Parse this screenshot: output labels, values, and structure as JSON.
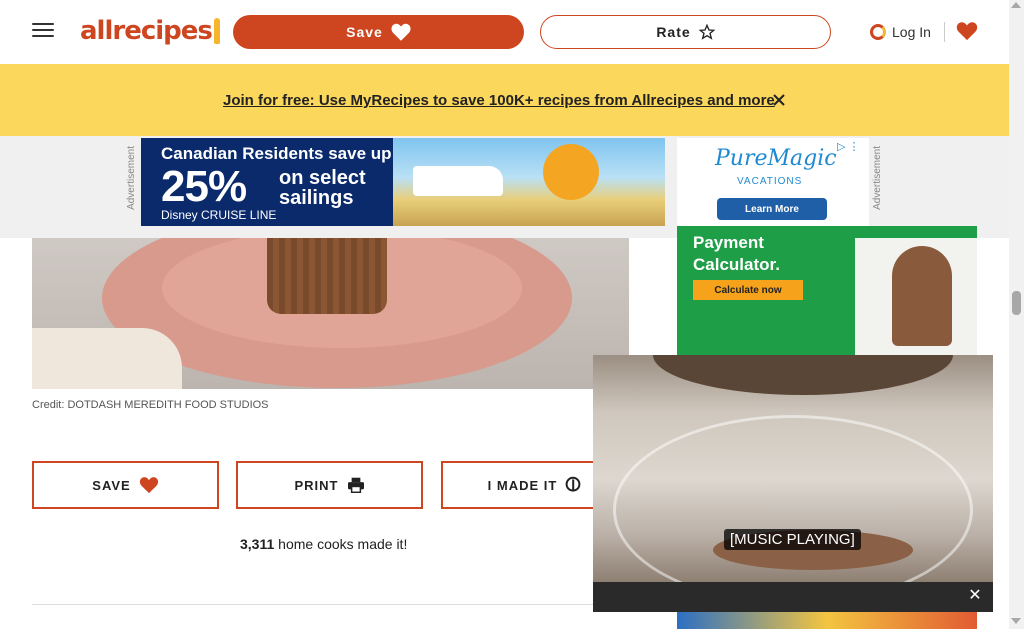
{
  "header": {
    "logo_text": "allrecipes",
    "save_label": "Save",
    "rate_label": "Rate",
    "login_label": "Log In"
  },
  "banner": {
    "text": "Join for free: Use MyRecipes to save 100K+ recipes from Allrecipes and more"
  },
  "ads": {
    "label": "Advertisement",
    "main": {
      "headline": "Canadian Residents save up to",
      "percent": "25%",
      "percent_sub_1": "on select",
      "percent_sub_2": "sailings",
      "brand": "Disney CRUISE LINE"
    },
    "side": {
      "brand": "PureMagic",
      "sub": "VACATIONS",
      "cta": "Learn More"
    },
    "rail": {
      "line1": "Payment",
      "line2": "Calculator.",
      "cta": "Calculate now"
    }
  },
  "recipe": {
    "credit": "Credit: DOTDASH MEREDITH FOOD STUDIOS",
    "actions": {
      "save": "SAVE",
      "print": "PRINT",
      "made_it": "I MADE IT"
    },
    "made_it_count": "3,311",
    "made_it_suffix": " home cooks made it!"
  },
  "video": {
    "caption": "[MUSIC PLAYING]",
    "close_symbol": "✕"
  },
  "colors": {
    "brand": "#ce4620",
    "banner": "#fbd75b",
    "accent_yellow": "#f7b52c"
  },
  "icons": {
    "menu": "hamburger-icon",
    "save": "heart-icon",
    "rate": "star-icon",
    "login": "user-ring-icon",
    "print": "printer-icon",
    "made_it": "spoon-icon",
    "adchoices": "ad-choices-icon"
  }
}
